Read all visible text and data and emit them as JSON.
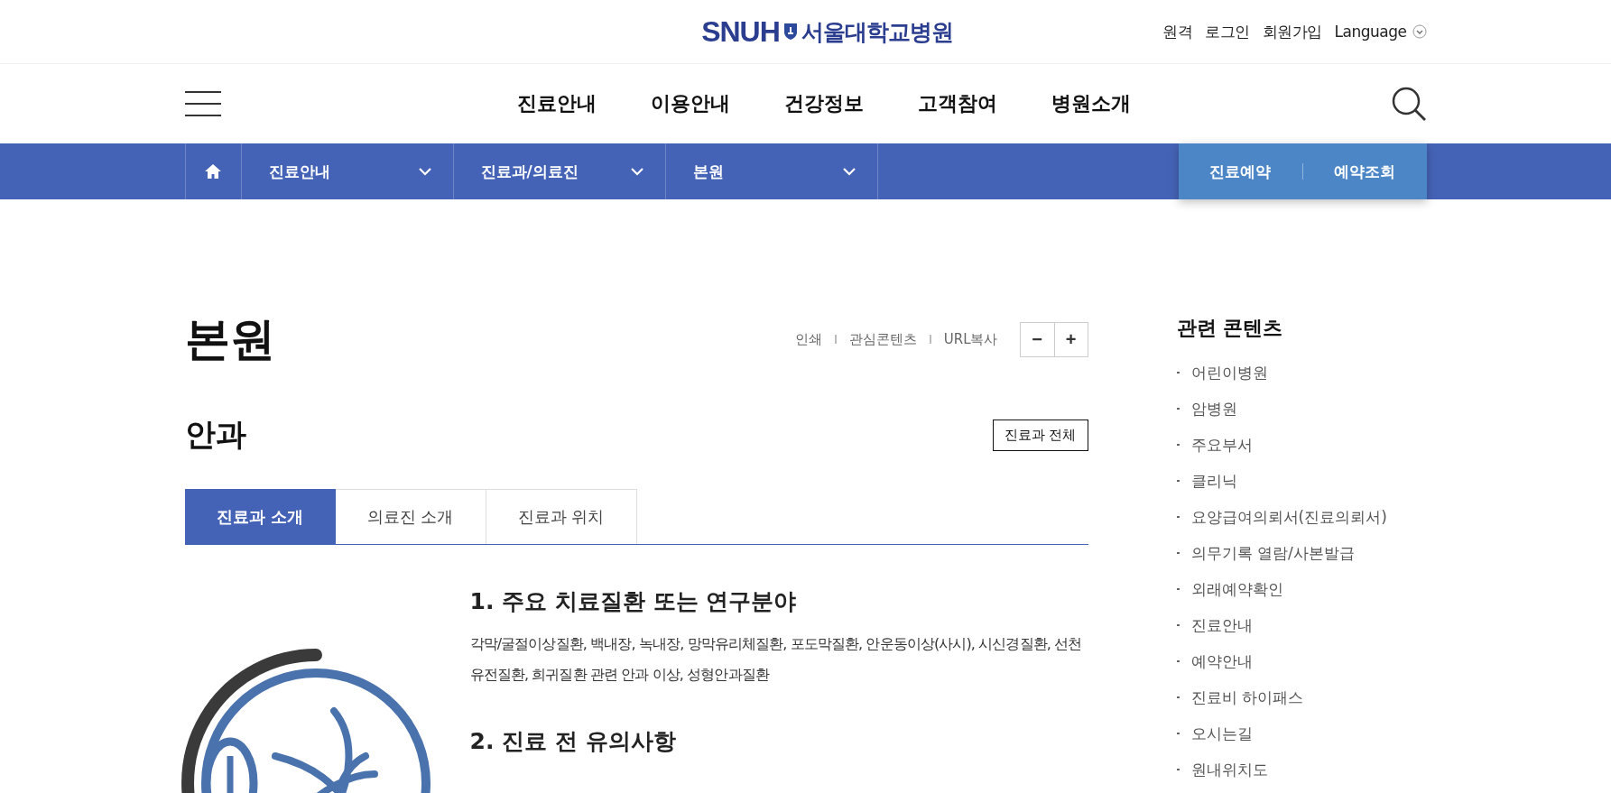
{
  "header": {
    "logo": {
      "mark": "SNUH",
      "name": "서울대학교병원"
    },
    "utility_links": [
      "원격",
      "로그인",
      "회원가입"
    ],
    "language": "Language"
  },
  "nav": {
    "items": [
      "진료안내",
      "이용안내",
      "건강정보",
      "고객참여",
      "병원소개"
    ]
  },
  "breadcrumb": {
    "items": [
      {
        "label": "진료안내"
      },
      {
        "label": "진료과/의료진"
      },
      {
        "label": "본원"
      }
    ],
    "actions": [
      "진료예약",
      "예약조회"
    ]
  },
  "page": {
    "title": "본원",
    "tools": [
      "인쇄",
      "관심콘텐츠",
      "URL복사"
    ],
    "zoom": [
      "−",
      "+"
    ]
  },
  "department": {
    "name": "안과",
    "all_button": "진료과 전체"
  },
  "tabs": [
    {
      "label": "진료과 소개",
      "selected": true
    },
    {
      "label": "의료진 소개",
      "selected": false
    },
    {
      "label": "진료과 위치",
      "selected": false
    }
  ],
  "sections": [
    {
      "heading": "1. 주요 치료질환 또는 연구분야",
      "body": "각막/굴절이상질환, 백내장, 녹내장, 망막유리체질환, 포도막질환, 안운동이상(사시), 시신경질환, 선천유전질환, 희귀질환 관련 안과 이상, 성형안과질환"
    },
    {
      "heading": "2. 진료 전 유의사항"
    }
  ],
  "related": {
    "title": "관련 콘텐츠",
    "items": [
      "어린이병원",
      "암병원",
      "주요부서",
      "클리닉",
      "요양급여의뢰서(진료의뢰서)",
      "의무기록 열람/사본발급",
      "외래예약확인",
      "진료안내",
      "예약안내",
      "진료비 하이패스",
      "오시는길",
      "원내위치도"
    ]
  }
}
